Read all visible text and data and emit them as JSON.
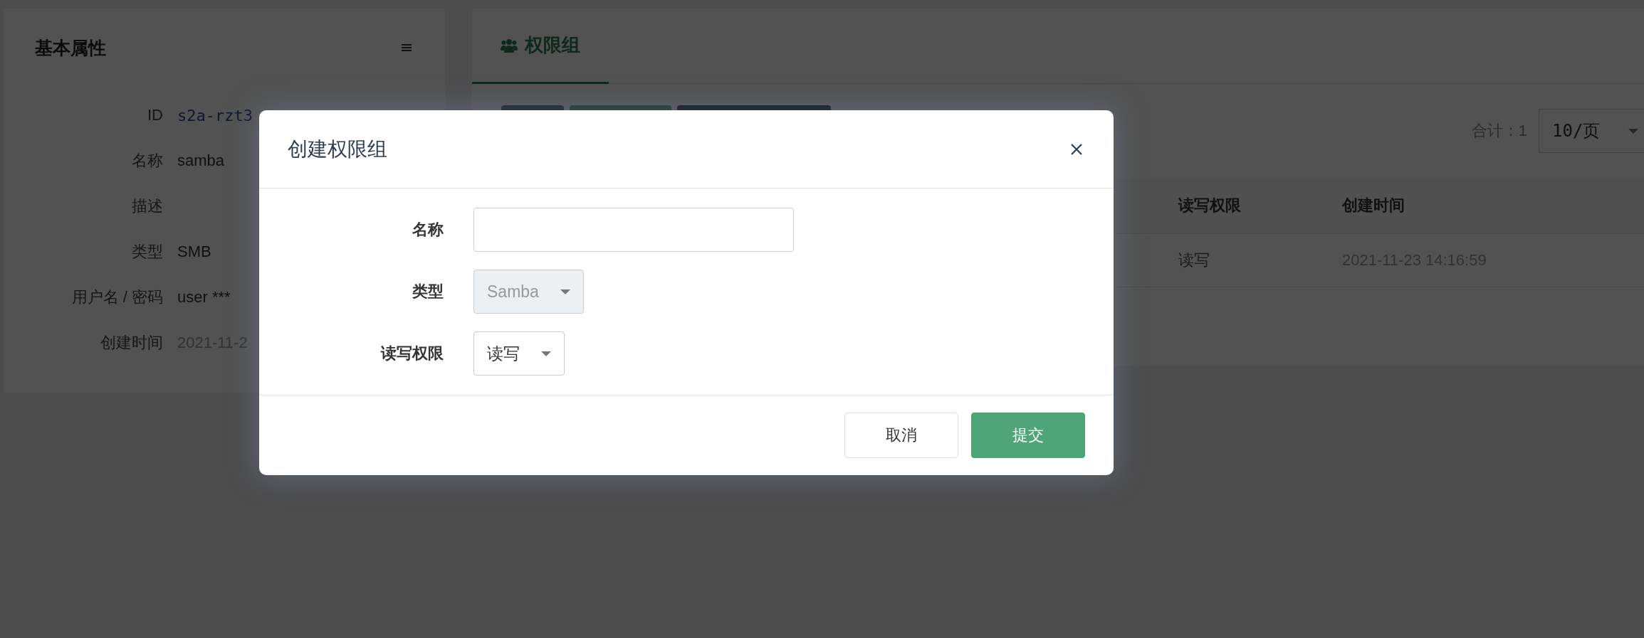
{
  "properties_panel": {
    "title": "基本属性",
    "fields": [
      {
        "label": "ID",
        "value": "s2a-rzt3",
        "kind": "code"
      },
      {
        "label": "名称",
        "value": "samba",
        "kind": "text"
      },
      {
        "label": "描述"
      },
      {
        "label": "类型",
        "value": "SMB",
        "kind": "text"
      },
      {
        "label": "用户名 / 密码",
        "value": "user ***",
        "kind": "text"
      },
      {
        "label": "创建时间",
        "value": "2021-11-2",
        "kind": "muted"
      }
    ]
  },
  "groups_panel": {
    "tabs": [
      {
        "label": "权限组",
        "selected": true
      }
    ],
    "toolbar_buttons": [
      {
        "kind": "default"
      },
      {
        "kind": "primary"
      },
      {
        "kind": "dark"
      }
    ],
    "total": "合计：1",
    "page_size": "10/页",
    "table": {
      "columns": [
        "读写权限",
        "创建时间"
      ],
      "rows": [
        [
          "读写",
          "2021-11-23 14:16:59"
        ]
      ]
    }
  },
  "dialog": {
    "title": "创建权限组",
    "fields": [
      {
        "label": "名称",
        "kind": "input"
      },
      {
        "label": "类型",
        "kind": "select",
        "value": "Samba",
        "disabled": true
      },
      {
        "label": "读写权限",
        "kind": "select",
        "value": "读写",
        "disabled": false
      }
    ],
    "buttons": [
      {
        "label": "取消",
        "kind": "default"
      },
      {
        "label": "提交",
        "kind": "primary"
      }
    ]
  }
}
